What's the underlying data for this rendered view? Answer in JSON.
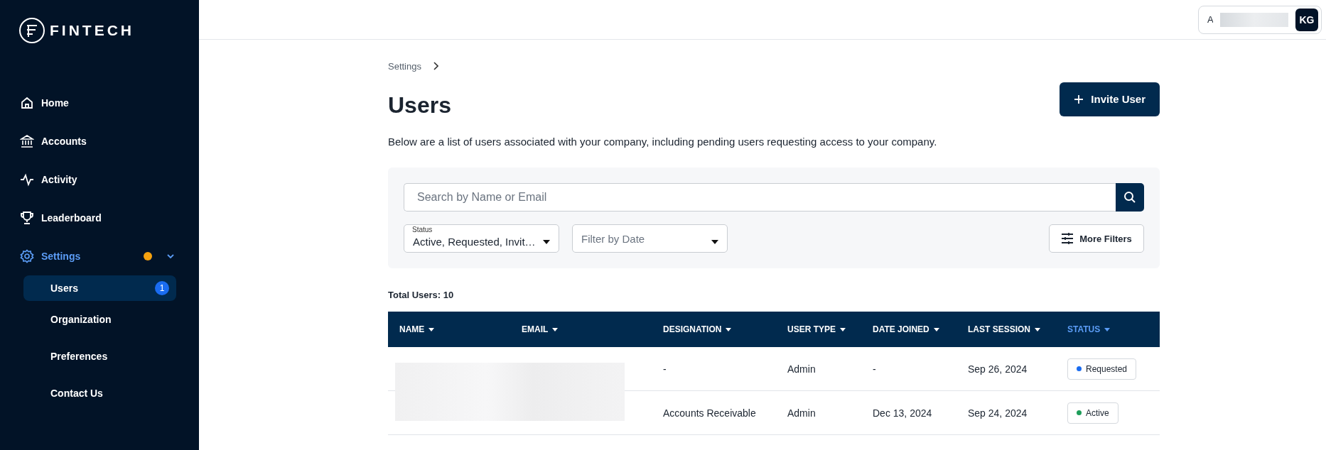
{
  "logo": {
    "text": "FINTECH"
  },
  "sidebar": {
    "items": [
      {
        "label": "Home",
        "kind": "home",
        "selected": false
      },
      {
        "label": "Accounts",
        "kind": "bank",
        "selected": false
      },
      {
        "label": "Activity",
        "kind": "pulse",
        "selected": false
      },
      {
        "label": "Leaderboard",
        "kind": "trophy",
        "selected": false
      },
      {
        "label": "Settings",
        "kind": "gear",
        "selected": true,
        "expanded": true,
        "alert": true,
        "children": [
          {
            "label": "Users",
            "selected": true,
            "badge": "1"
          },
          {
            "label": "Organization",
            "selected": false
          },
          {
            "label": "Preferences",
            "selected": false
          },
          {
            "label": "Contact Us",
            "selected": false
          }
        ]
      }
    ]
  },
  "topbar": {
    "account_initial": "A",
    "avatar": "KG"
  },
  "breadcrumb": [
    "Settings"
  ],
  "page": {
    "title": "Users",
    "description": "Below are a list of users associated with your company, including pending users requesting access to your company.",
    "invite_button": "Invite User"
  },
  "filters": {
    "search": {
      "placeholder": "Search by Name or Email"
    },
    "status": {
      "label": "Status",
      "value": "Active, Requested, Invit…"
    },
    "date": {
      "placeholder": "Filter by Date"
    },
    "more_button": "More Filters"
  },
  "total": "Total Users: 10",
  "table": {
    "columns": [
      {
        "label": "NAME",
        "selected": false
      },
      {
        "label": "EMAIL",
        "selected": false
      },
      {
        "label": "DESIGNATION",
        "selected": false
      },
      {
        "label": "USER TYPE",
        "selected": false
      },
      {
        "label": "DATE JOINED",
        "selected": false
      },
      {
        "label": "LAST SESSION",
        "selected": false
      },
      {
        "label": "STATUS",
        "selected": true
      }
    ],
    "rows": [
      {
        "designation": "-",
        "user_type": "Admin",
        "date_joined": "-",
        "last_session": "Sep 26, 2024",
        "status": {
          "label": "Requested",
          "color": "#1a6cf0"
        }
      },
      {
        "designation": "Accounts Receivable",
        "user_type": "Admin",
        "date_joined": "Dec 13, 2024",
        "last_session": "Sep 24, 2024",
        "status": {
          "label": "Active",
          "color": "#1e9e5a"
        }
      }
    ]
  }
}
